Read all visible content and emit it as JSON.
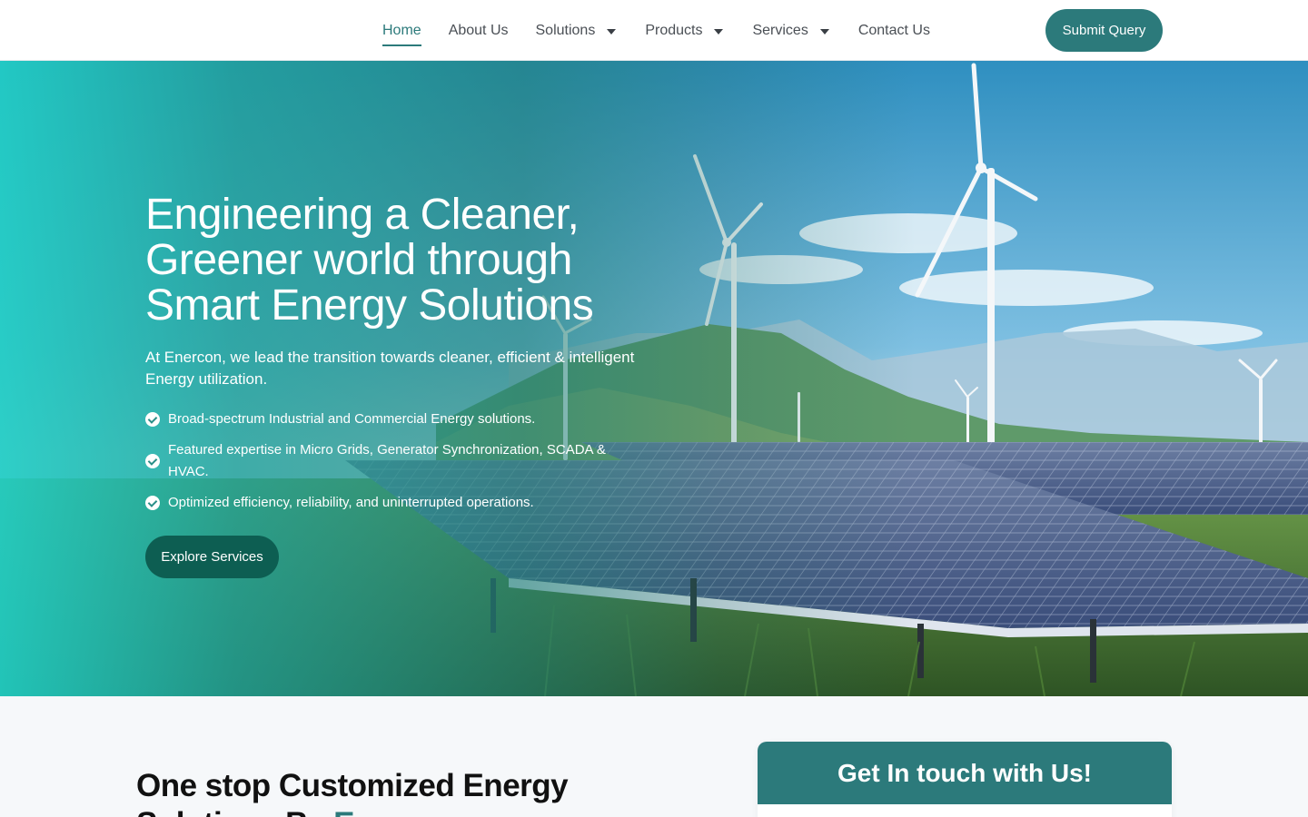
{
  "nav": {
    "items": [
      {
        "label": "Home",
        "active": true,
        "dropdown": false
      },
      {
        "label": "About Us",
        "active": false,
        "dropdown": false
      },
      {
        "label": "Solutions",
        "active": false,
        "dropdown": true
      },
      {
        "label": "Products",
        "active": false,
        "dropdown": true
      },
      {
        "label": "Services",
        "active": false,
        "dropdown": true
      },
      {
        "label": "Contact Us",
        "active": false,
        "dropdown": false
      }
    ],
    "cta_label": "Submit Query"
  },
  "hero": {
    "title_lines": [
      "Engineering a Cleaner,",
      "Greener world through",
      "Smart Energy Solutions"
    ],
    "subtitle": "At Enercon, we lead the transition towards cleaner, efficient & intelligent Energy utilization.",
    "features": [
      "Broad-spectrum Industrial and Commercial Energy solutions.",
      "Featured expertise in Micro Grids, Generator Synchronization, SCADA & HVAC.",
      "Optimized efficiency, reliability, and uninterrupted operations."
    ],
    "cta_label": "Explore Services"
  },
  "section": {
    "title_line1": "One stop Customized Energy",
    "title_line2_prefix": "Solutions By ",
    "title_line2_accent": "Enercon"
  },
  "contact": {
    "heading": "Get In touch with Us!"
  },
  "colors": {
    "brand": "#2c7a7b",
    "brand_dark": "#0d5e52",
    "hero_teal": "#21cdc4",
    "section_bg": "#f6f8fa"
  },
  "icons": {
    "dropdown": "caret-down-icon",
    "feature": "check-circle-icon"
  }
}
